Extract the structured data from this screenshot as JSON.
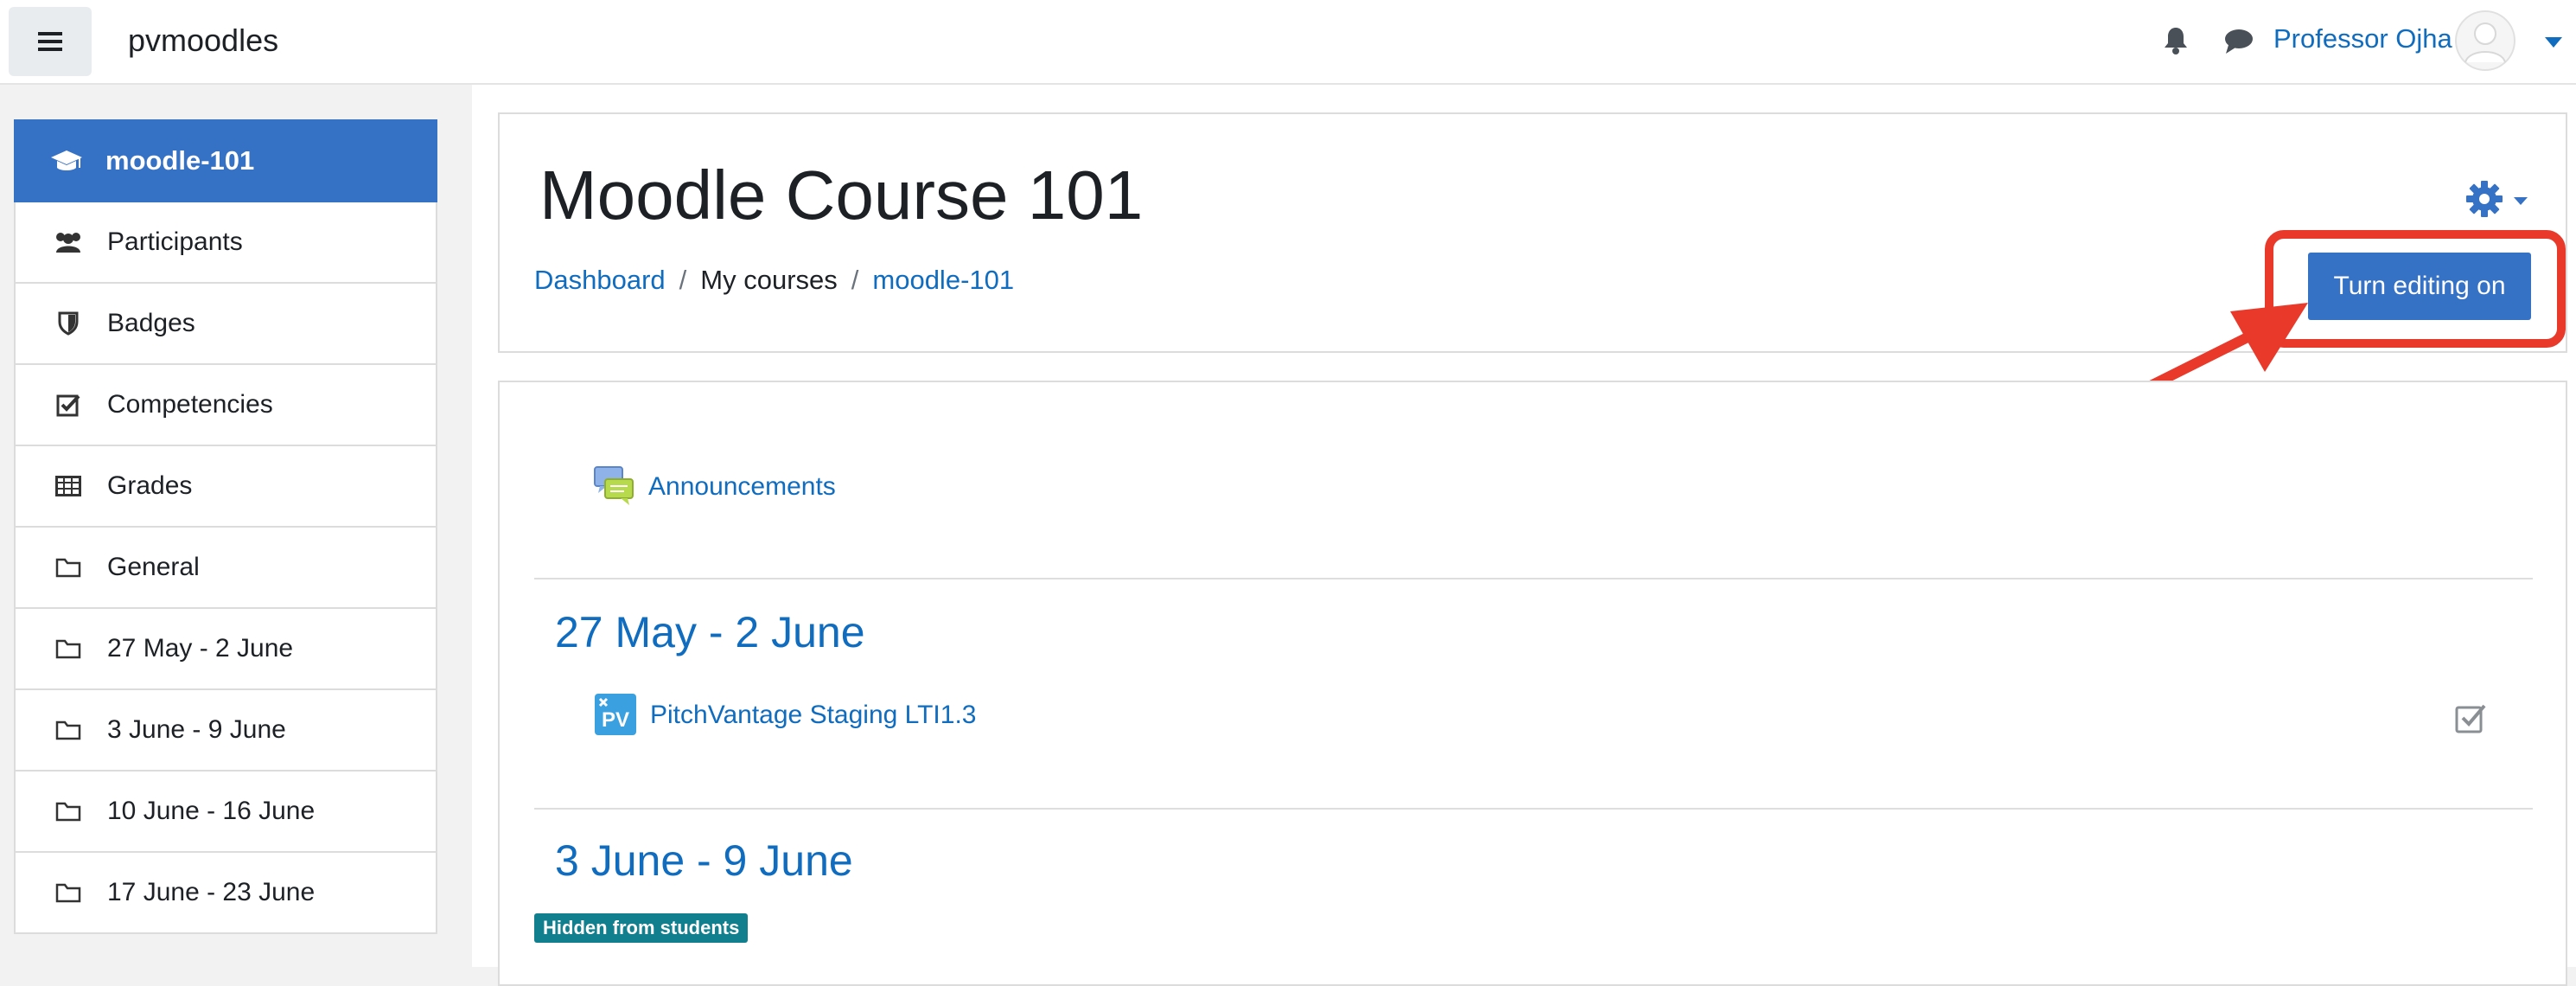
{
  "navbar": {
    "brand": "pvmoodles",
    "user_name": "Professor Ojha",
    "icons": [
      "hamburger-icon",
      "bell-icon",
      "chat-icon",
      "avatar-icon",
      "caret-down-icon"
    ]
  },
  "sidebar": {
    "items": [
      {
        "label": "moodle-101",
        "icon": "graduation-cap-icon",
        "active": true
      },
      {
        "label": "Participants",
        "icon": "users-icon"
      },
      {
        "label": "Badges",
        "icon": "shield-icon"
      },
      {
        "label": "Competencies",
        "icon": "checkbox-icon"
      },
      {
        "label": "Grades",
        "icon": "table-icon"
      },
      {
        "label": "General",
        "icon": "folder-icon"
      },
      {
        "label": "27 May - 2 June",
        "icon": "folder-icon"
      },
      {
        "label": "3 June - 9 June",
        "icon": "folder-icon"
      },
      {
        "label": "10 June - 16 June",
        "icon": "folder-icon"
      },
      {
        "label": "17 June - 23 June",
        "icon": "folder-icon"
      }
    ]
  },
  "header": {
    "title": "Moodle Course 101",
    "breadcrumb": {
      "dashboard": "Dashboard",
      "my_courses": "My courses",
      "course": "moodle-101",
      "separator": "/"
    },
    "edit_button": "Turn editing on"
  },
  "content": {
    "announcements": "Announcements",
    "sections": [
      {
        "title": "27 May - 2 June",
        "activity": "PitchVantage Staging LTI1.3"
      },
      {
        "title": "3 June - 9 June",
        "badge": "Hidden from students"
      }
    ],
    "pv_icon_text": "PV"
  },
  "colors": {
    "primary": "#3572c6",
    "link": "#0f6cbf",
    "annotation": "#e8392a",
    "badge": "#117f8e"
  }
}
